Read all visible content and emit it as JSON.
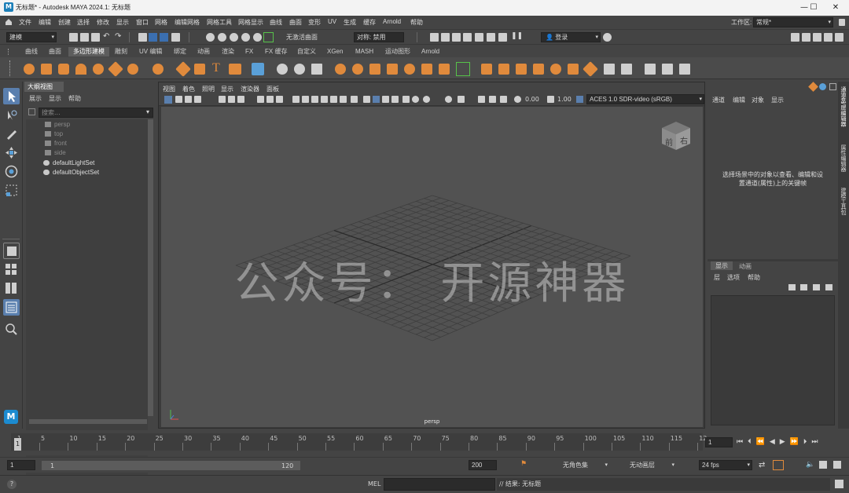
{
  "window": {
    "title": "无标题* - Autodesk MAYA 2024.1: 无标题",
    "logo": "M"
  },
  "menu": [
    "文件",
    "编辑",
    "创建",
    "选择",
    "修改",
    "显示",
    "窗口",
    "网格",
    "编辑网格",
    "网格工具",
    "网格显示",
    "曲线",
    "曲面",
    "变形",
    "UV",
    "生成",
    "缓存",
    "Arnold",
    "帮助"
  ],
  "workspace": {
    "label": "工作区:",
    "value": "常规*"
  },
  "statusline": {
    "mode": "建模",
    "live_surface": "无激活曲面",
    "symmetry": "对称: 禁用",
    "login": "登录"
  },
  "shelf_tabs": [
    "曲线",
    "曲面",
    "多边形建模",
    "雕刻",
    "UV 编辑",
    "绑定",
    "动画",
    "渲染",
    "FX",
    "FX 缓存",
    "自定义",
    "XGen",
    "MASH",
    "运动图形",
    "Arnold"
  ],
  "shelf_active": "多边形建模",
  "outliner": {
    "tab": "大纲视图",
    "menus": [
      "展示",
      "显示",
      "帮助"
    ],
    "search_placeholder": "搜索...",
    "items": [
      "persp",
      "top",
      "front",
      "side",
      "defaultLightSet",
      "defaultObjectSet"
    ]
  },
  "viewport": {
    "menus": [
      "视图",
      "着色",
      "照明",
      "显示",
      "渲染器",
      "面板"
    ],
    "value_a": "0.00",
    "value_b": "1.00",
    "colorspace": "ACES 1.0 SDR-video (sRGB)",
    "camera_label": "persp",
    "watermark": "公众号： 开源神器",
    "viewcube_front": "前",
    "viewcube_right": "右"
  },
  "channelbox": {
    "menus": [
      "通道",
      "编辑",
      "对象",
      "显示"
    ],
    "message": "选择场景中的对象以查看、编辑和设置通道(属性)上的关键帧",
    "layer_tabs": [
      "显示",
      "动画"
    ],
    "layer_menus": [
      "层",
      "选项",
      "帮助"
    ]
  },
  "side_tabs": [
    "通道盒/层编辑器",
    "属性编辑器",
    "建模工具包"
  ],
  "timeline": {
    "ticks": [
      "1",
      "5",
      "10",
      "15",
      "20",
      "25",
      "30",
      "35",
      "40",
      "45",
      "50",
      "55",
      "60",
      "65",
      "70",
      "75",
      "80",
      "85",
      "90",
      "95",
      "100",
      "105",
      "110",
      "115",
      "12"
    ],
    "current_frame": "1"
  },
  "range": {
    "start": "1",
    "inner_start": "1",
    "inner_end": "120",
    "end": "200",
    "character_set": "无角色集",
    "anim_layer": "无动画层",
    "fps": "24 fps"
  },
  "cmd": {
    "lang": "MEL",
    "result": "// 结果: 无标题"
  }
}
